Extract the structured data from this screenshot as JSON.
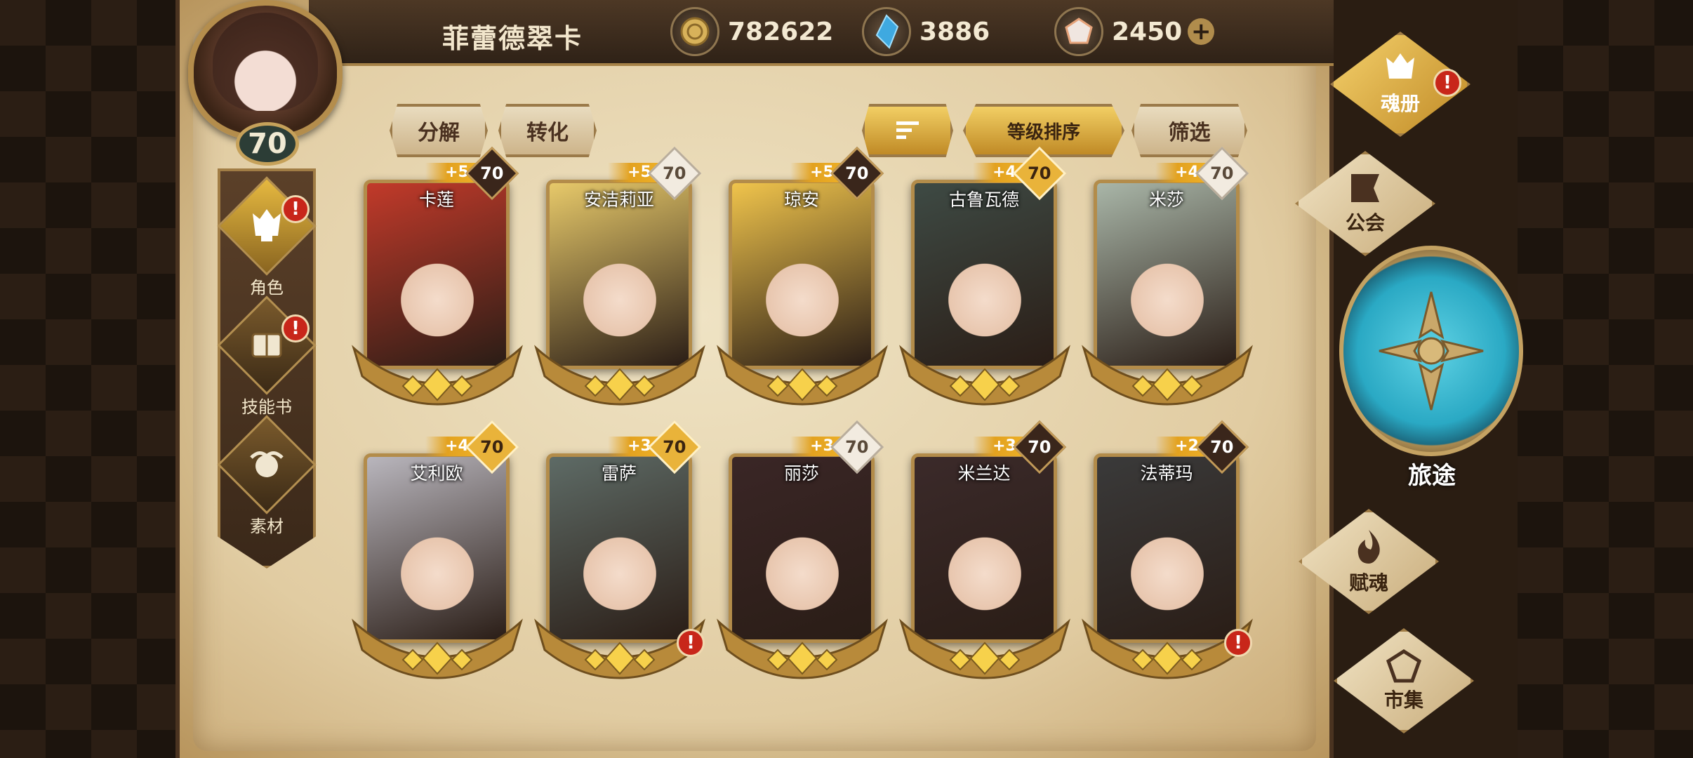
{
  "player": {
    "name": "菲蕾德翠卡",
    "level": "70"
  },
  "currency": {
    "gold": "782622",
    "crystal": "3886",
    "gem": "2450",
    "plus": "+"
  },
  "actions": {
    "decompose": "分解",
    "convert": "转化",
    "level_sort": "等级排序",
    "filter": "筛选"
  },
  "left_menu": [
    {
      "label": "角色",
      "alert": "!"
    },
    {
      "label": "技能书",
      "alert": "!"
    },
    {
      "label": "素材"
    }
  ],
  "heroes": [
    {
      "name": "卡莲",
      "plus": "+5",
      "level": "70",
      "level_style": "dark",
      "color": "#c23a2a"
    },
    {
      "name": "安洁莉亚",
      "plus": "+5",
      "level": "70",
      "level_style": "light",
      "color": "#e7c96a"
    },
    {
      "name": "琼安",
      "plus": "+5",
      "level": "70",
      "level_style": "dark",
      "color": "#f0c44c"
    },
    {
      "name": "古鲁瓦德",
      "plus": "+4",
      "level": "70",
      "level_style": "gold",
      "color": "#3e4a44"
    },
    {
      "name": "米莎",
      "plus": "+4",
      "level": "70",
      "level_style": "light",
      "color": "#a9b6a8"
    },
    {
      "name": "艾利欧",
      "plus": "+4",
      "level": "70",
      "level_style": "gold",
      "color": "#b9b6bd"
    },
    {
      "name": "雷萨",
      "plus": "+3",
      "level": "70",
      "level_style": "gold",
      "color": "#5e6b66",
      "alert": "!"
    },
    {
      "name": "丽莎",
      "plus": "+3",
      "level": "70",
      "level_style": "light",
      "color": "#3a2626"
    },
    {
      "name": "米兰达",
      "plus": "+3",
      "level": "70",
      "level_style": "dark",
      "color": "#3b2a2a"
    },
    {
      "name": "法蒂玛",
      "plus": "+2",
      "level": "70",
      "level_style": "dark",
      "color": "#3a3a3a",
      "alert": "!"
    }
  ],
  "right_menu": {
    "soulbook": {
      "label": "魂册",
      "alert": "!"
    },
    "guild": "公会",
    "journey": "旅途",
    "ascend": "赋魂",
    "market": "市集"
  },
  "colors": {
    "accent_gold": "#e3a21f",
    "alert_red": "#c8261a",
    "journey_teal": "#2aa9c4"
  }
}
